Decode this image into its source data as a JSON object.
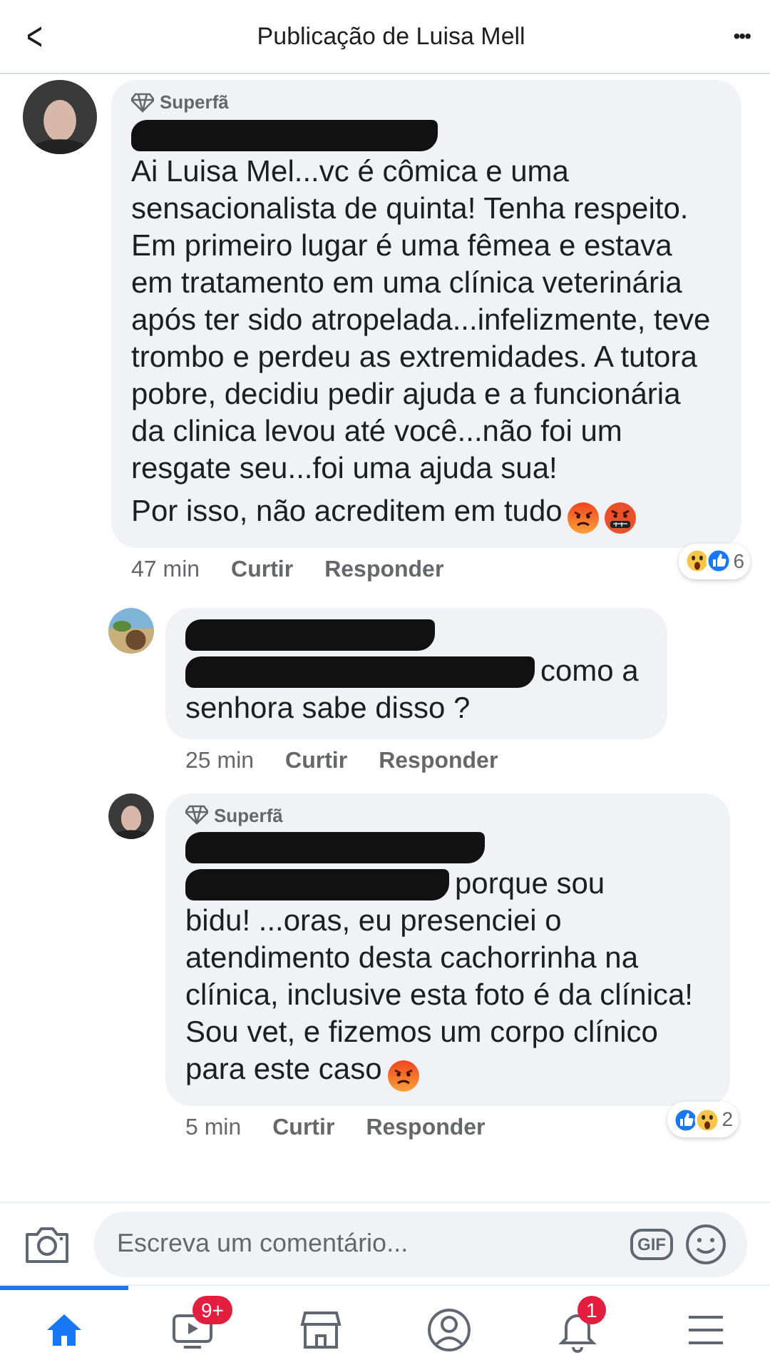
{
  "header": {
    "back": "<",
    "title": "Publicação de Luisa Mell",
    "more": "•••"
  },
  "comments": [
    {
      "kind": "picture",
      "badge": "Superfã",
      "redactions": [
        {
          "kind": "line"
        }
      ],
      "paragraphs": [
        {
          "text": "Ai Luisa Mel...vc é cômica e uma sensacionalista de quinta! Tenha respeito. Em primeiro lugar é uma fêmea e estava em tratamento em uma clínica veterinária após ter sido atropelada...infelizmente, teve trombo e perdeu as extremidades. A tutora pobre, decidiu pedir ajuda e a funcionária da clinica levou até você...não foi um resgate seu...foi uma ajuda sua!"
        },
        {
          "text": "Por isso, não acreditem em tudo",
          "emojis": [
            {
              "kind": "angry"
            },
            {
              "kind": "cursing"
            }
          ]
        }
      ],
      "time": "47 min",
      "actions": [
        "Curtir",
        "Responder"
      ],
      "reactions": [
        {
          "kind": "wow"
        },
        {
          "kind": "like"
        }
      ],
      "reaction_count": "6",
      "children": [
        {
          "kind": "picture",
          "redactions": [
            {
              "kind": "line"
            },
            {
              "kind": "inline"
            }
          ],
          "lead": "como a",
          "paragraphs": [
            {
              "text": "senhora sabe disso ?"
            }
          ],
          "time": "25 min",
          "actions": [
            "Curtir",
            "Responder"
          ]
        },
        {
          "kind": "picture",
          "badge": "Superfã",
          "redactions": [
            {
              "kind": "line"
            },
            {
              "kind": "inline"
            }
          ],
          "lead": "porque sou",
          "paragraphs": [
            {
              "text": "bidu! ...oras, eu presenciei o atendimento desta cachorrinha na clínica,  inclusive esta foto é da clínica! Sou vet, e fizemos um corpo clínico para este caso",
              "emojis": [
                {
                  "kind": "angry"
                }
              ]
            }
          ],
          "time": "5 min",
          "actions": [
            "Curtir",
            "Responder"
          ],
          "reactions": [
            {
              "kind": "like"
            },
            {
              "kind": "wow"
            }
          ],
          "reaction_count": "2"
        }
      ]
    }
  ],
  "composer": {
    "placeholder": "Escreva um comentário...",
    "gif": "GIF"
  },
  "tabs": [
    {
      "kind": "home",
      "selected": true
    },
    {
      "kind": "video",
      "selected": false,
      "badge": "9+"
    },
    {
      "kind": "market",
      "selected": false
    },
    {
      "kind": "profile",
      "selected": false
    },
    {
      "kind": "bell",
      "selected": false,
      "badge": "1"
    },
    {
      "kind": "menu",
      "selected": false
    }
  ]
}
